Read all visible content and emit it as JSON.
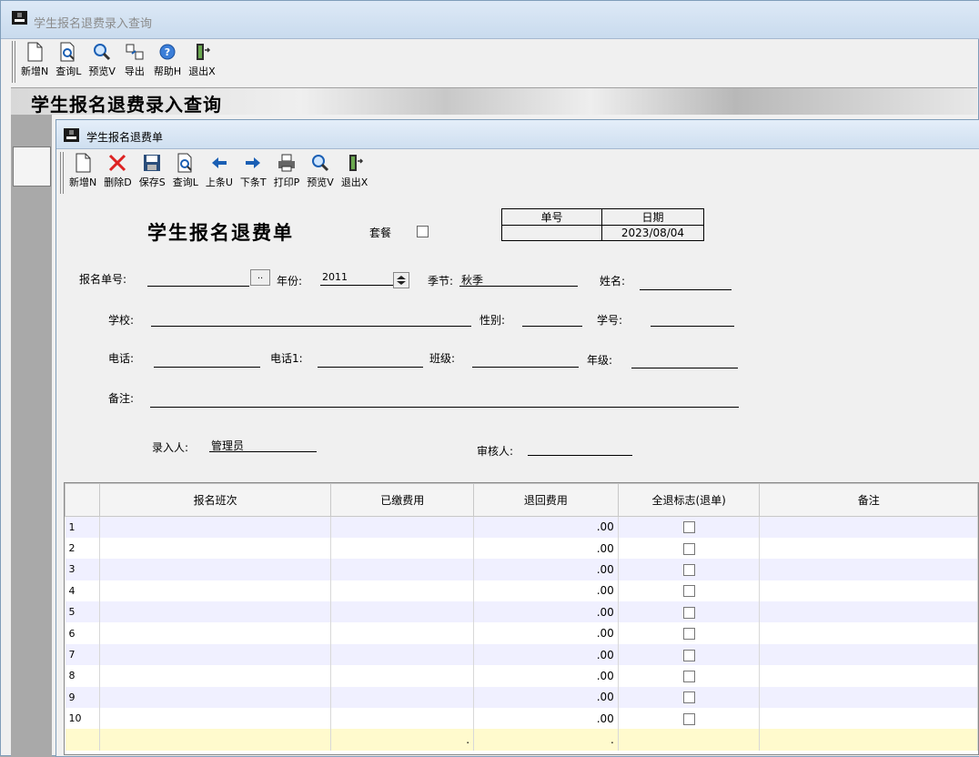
{
  "outer": {
    "title": "学生报名退费录入查询",
    "banner": "学生报名退费录入查询",
    "toolbar": [
      {
        "icon": "new-doc-icon",
        "label": "新增N"
      },
      {
        "icon": "query-icon",
        "label": "查询L"
      },
      {
        "icon": "preview-icon",
        "label": "预览V"
      },
      {
        "icon": "export-icon",
        "label": "导出"
      },
      {
        "icon": "help-icon",
        "label": "帮助H"
      },
      {
        "icon": "exit-icon",
        "label": "退出X"
      }
    ]
  },
  "inner": {
    "title": "学生报名退费单",
    "toolbar": [
      {
        "icon": "new-doc-icon",
        "label": "新增N"
      },
      {
        "icon": "delete-icon",
        "label": "删除D"
      },
      {
        "icon": "save-icon",
        "label": "保存S"
      },
      {
        "icon": "query-icon",
        "label": "查询L"
      },
      {
        "icon": "prev-arrow-icon",
        "label": "上条U"
      },
      {
        "icon": "next-arrow-icon",
        "label": "下条T"
      },
      {
        "icon": "print-icon",
        "label": "打印P"
      },
      {
        "icon": "preview-icon",
        "label": "预览V"
      },
      {
        "icon": "exit-icon",
        "label": "退出X"
      }
    ]
  },
  "form": {
    "title": "学生报名退费单",
    "package_label": "套餐",
    "header_table": {
      "col1": "单号",
      "col2": "日期",
      "bill_no": "",
      "date": "2023/08/04"
    },
    "fields": {
      "reg_no_label": "报名单号:",
      "reg_no_value": "",
      "browse_btn": "..",
      "year_label": "年份:",
      "year_value": "2011",
      "season_label": "季节:",
      "season_value": "秋季",
      "name_label": "姓名:",
      "name_value": "",
      "school_label": "学校:",
      "school_value": "",
      "gender_label": "性别:",
      "gender_value": "",
      "student_no_label": "学号:",
      "student_no_value": "",
      "phone_label": "电话:",
      "phone_value": "",
      "phone1_label": "电话1:",
      "phone1_value": "",
      "class_label": "班级:",
      "class_value": "",
      "grade_label": "年级:",
      "grade_value": "",
      "remark_label": "备注:",
      "remark_value": "",
      "entered_by_label": "录入人:",
      "entered_by_value": "管理员",
      "reviewer_label": "审核人:",
      "reviewer_value": ""
    }
  },
  "grid": {
    "columns": [
      "报名班次",
      "已缴费用",
      "退回费用",
      "全退标志(退单)",
      "备注"
    ],
    "rows": [
      {
        "n": "1",
        "refund": ".00"
      },
      {
        "n": "2",
        "refund": ".00"
      },
      {
        "n": "3",
        "refund": ".00"
      },
      {
        "n": "4",
        "refund": ".00"
      },
      {
        "n": "5",
        "refund": ".00"
      },
      {
        "n": "6",
        "refund": ".00"
      },
      {
        "n": "7",
        "refund": ".00"
      },
      {
        "n": "8",
        "refund": ".00"
      },
      {
        "n": "9",
        "refund": ".00"
      },
      {
        "n": "10",
        "refund": ".00"
      }
    ],
    "new_row": {
      "paid": ".",
      "refund": "."
    }
  }
}
